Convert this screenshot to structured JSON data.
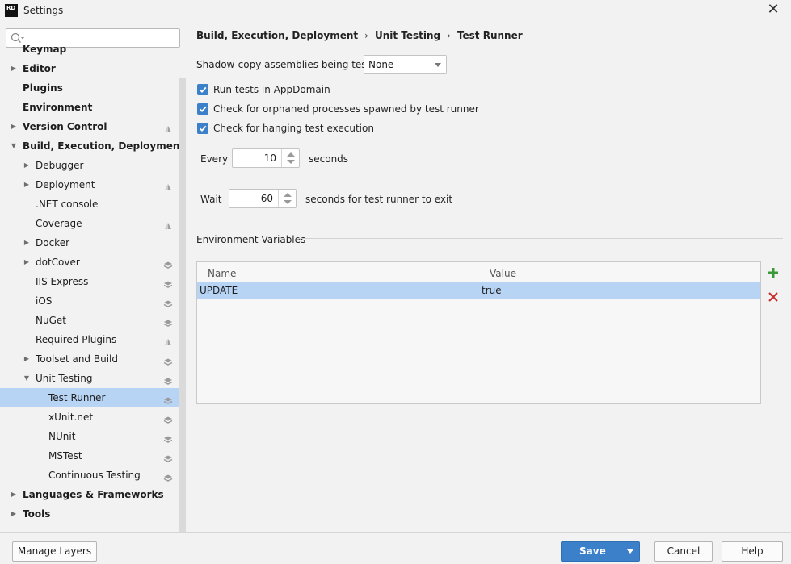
{
  "window": {
    "title": "Settings",
    "logo_text": "RD"
  },
  "search": {
    "placeholder": "",
    "value": ""
  },
  "tree": [
    {
      "label": "Keymap",
      "bold": true,
      "indent": 0,
      "arrow": "",
      "icon": ""
    },
    {
      "label": "Editor",
      "bold": true,
      "indent": 0,
      "arrow": "right",
      "icon": ""
    },
    {
      "label": "Plugins",
      "bold": true,
      "indent": 0,
      "arrow": "",
      "icon": ""
    },
    {
      "label": "Environment",
      "bold": true,
      "indent": 0,
      "arrow": "",
      "icon": ""
    },
    {
      "label": "Version Control",
      "bold": true,
      "indent": 0,
      "arrow": "right",
      "icon": "project-icon"
    },
    {
      "label": "Build, Execution, Deployment",
      "bold": true,
      "indent": 0,
      "arrow": "down",
      "icon": ""
    },
    {
      "label": "Debugger",
      "bold": false,
      "indent": 1,
      "arrow": "right",
      "icon": ""
    },
    {
      "label": "Deployment",
      "bold": false,
      "indent": 1,
      "arrow": "right",
      "icon": "project-icon"
    },
    {
      "label": ".NET console",
      "bold": false,
      "indent": 1,
      "arrow": "",
      "icon": ""
    },
    {
      "label": "Coverage",
      "bold": false,
      "indent": 1,
      "arrow": "",
      "icon": "project-icon"
    },
    {
      "label": "Docker",
      "bold": false,
      "indent": 1,
      "arrow": "right",
      "icon": ""
    },
    {
      "label": "dotCover",
      "bold": false,
      "indent": 1,
      "arrow": "right",
      "icon": "layers-icon"
    },
    {
      "label": "IIS Express",
      "bold": false,
      "indent": 1,
      "arrow": "",
      "icon": "layers-icon"
    },
    {
      "label": "iOS",
      "bold": false,
      "indent": 1,
      "arrow": "",
      "icon": "layers-icon"
    },
    {
      "label": "NuGet",
      "bold": false,
      "indent": 1,
      "arrow": "",
      "icon": "layers-icon"
    },
    {
      "label": "Required Plugins",
      "bold": false,
      "indent": 1,
      "arrow": "",
      "icon": "project-icon"
    },
    {
      "label": "Toolset and Build",
      "bold": false,
      "indent": 1,
      "arrow": "right",
      "icon": "layers-icon"
    },
    {
      "label": "Unit Testing",
      "bold": false,
      "indent": 1,
      "arrow": "down",
      "icon": "layers-icon"
    },
    {
      "label": "Test Runner",
      "bold": false,
      "indent": 2,
      "arrow": "",
      "icon": "layers-icon",
      "selected": true
    },
    {
      "label": "xUnit.net",
      "bold": false,
      "indent": 2,
      "arrow": "",
      "icon": "layers-icon"
    },
    {
      "label": "NUnit",
      "bold": false,
      "indent": 2,
      "arrow": "",
      "icon": "layers-icon"
    },
    {
      "label": "MSTest",
      "bold": false,
      "indent": 2,
      "arrow": "",
      "icon": "layers-icon"
    },
    {
      "label": "Continuous Testing",
      "bold": false,
      "indent": 2,
      "arrow": "",
      "icon": "layers-icon"
    },
    {
      "label": "Languages & Frameworks",
      "bold": true,
      "indent": 0,
      "arrow": "right",
      "icon": ""
    },
    {
      "label": "Tools",
      "bold": true,
      "indent": 0,
      "arrow": "right",
      "icon": ""
    }
  ],
  "breadcrumb": {
    "part1": "Build, Execution, Deployment",
    "sep": "›",
    "part2": "Unit Testing",
    "part3": "Test Runner"
  },
  "shadow_copy": {
    "label": "Shadow-copy assemblies being tested",
    "value": "None"
  },
  "checks": [
    {
      "label": "Run tests in AppDomain",
      "checked": true
    },
    {
      "label": "Check for orphaned processes spawned by test runner",
      "checked": true
    },
    {
      "label": "Check for hanging test execution",
      "checked": true
    }
  ],
  "every": {
    "label": "Every",
    "value": "10",
    "suffix": "seconds"
  },
  "wait": {
    "label": "Wait",
    "value": "60",
    "suffix": "seconds for test runner to exit"
  },
  "env": {
    "title": "Environment Variables",
    "columns": [
      "Name",
      "Value"
    ],
    "rows": [
      {
        "name": "UPDATE",
        "value": "true"
      }
    ]
  },
  "footer": {
    "manage_layers": "Manage Layers",
    "save": "Save",
    "cancel": "Cancel",
    "help": "Help"
  },
  "colors": {
    "accent": "#3c80c9",
    "selection": "#b7d4f5",
    "add": "#3a9a3a",
    "remove": "#c9302c"
  }
}
